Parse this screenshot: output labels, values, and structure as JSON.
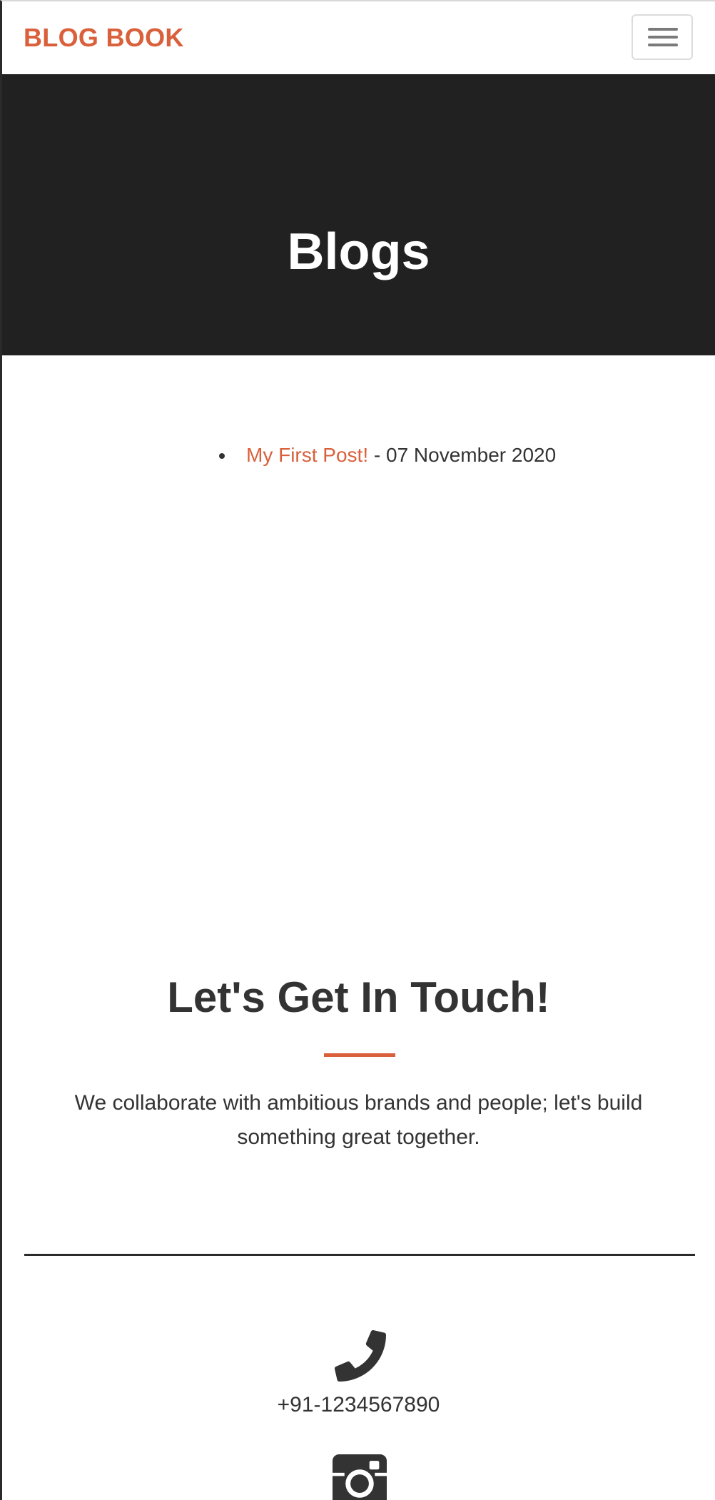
{
  "navbar": {
    "brand": "BLOG BOOK",
    "menu_icon": "hamburger-menu-icon"
  },
  "hero": {
    "title": "Blogs"
  },
  "blog_posts": [
    {
      "title": "My First Post!",
      "date_text": " - 07 November 2020"
    }
  ],
  "contact": {
    "heading": "Let's Get In Touch!",
    "text": "We collaborate with ambitious brands and people; let's build something great together.",
    "phone_icon": "phone-icon",
    "phone": "+91-1234567890",
    "instagram_icon": "instagram-icon"
  },
  "colors": {
    "accent": "#d9603b",
    "hero_background": "#212121",
    "text": "#333333"
  }
}
